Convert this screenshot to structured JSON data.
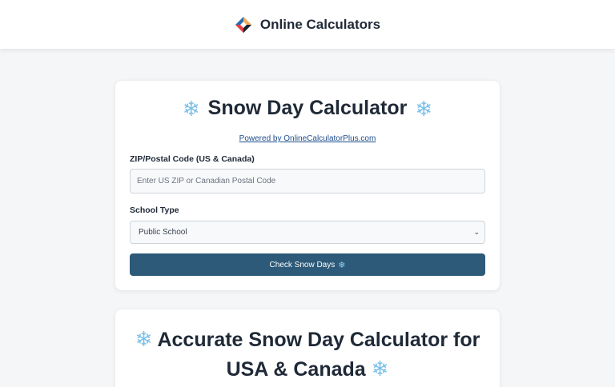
{
  "header": {
    "brand_name": "Online Calculators",
    "logo_icon": "diamond-logo-icon"
  },
  "calculator": {
    "title": "Snow Day Calculator",
    "title_icon": "snowflake-icon",
    "powered_by": "Powered by OnlineCalculatorPlus.com",
    "zip_label": "ZIP/Postal Code (US & Canada)",
    "zip_placeholder": "Enter US ZIP or Canadian Postal Code",
    "zip_value": "",
    "school_label": "School Type",
    "school_selected": "Public School",
    "button_label": "Check Snow Days",
    "button_icon": "snowflake-icon"
  },
  "info": {
    "title_line1": "Accurate Snow Day Calculator for",
    "title_line2": "USA & Canada"
  },
  "colors": {
    "button": "#2c5a78",
    "snowflake": "#7cc0e8",
    "link": "#1f4e8c"
  }
}
